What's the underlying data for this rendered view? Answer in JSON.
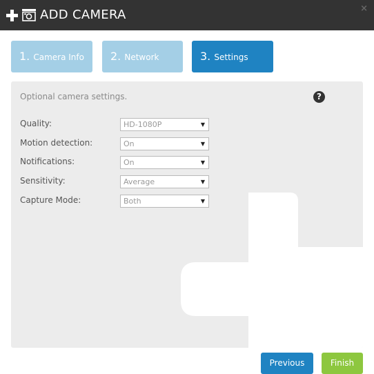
{
  "header": {
    "title": "ADD CAMERA",
    "icons": [
      "plus-icon",
      "camera-icon"
    ],
    "close_glyph": "×",
    "background": "#333333"
  },
  "steps": [
    {
      "number": "1.",
      "label": "Camera Info",
      "state": "completed",
      "color": "#a4cfe6"
    },
    {
      "number": "2.",
      "label": "Network",
      "state": "completed",
      "color": "#a4cfe6"
    },
    {
      "number": "3.",
      "label": "Settings",
      "state": "active",
      "color": "#1f83c2"
    }
  ],
  "panel": {
    "description": "Optional camera settings.",
    "help_glyph": "?"
  },
  "settings": {
    "quality": {
      "label": "Quality:",
      "value": "HD-1080P"
    },
    "motion_detection": {
      "label": "Motion detection:",
      "value": "On"
    },
    "notifications": {
      "label": "Notifications:",
      "value": "On"
    },
    "sensitivity": {
      "label": "Sensitivity:",
      "value": "Average"
    },
    "capture_mode": {
      "label": "Capture Mode:",
      "value": "Both"
    }
  },
  "footer": {
    "previous_label": "Previous",
    "finish_label": "Finish",
    "previous_color": "#1f83c2",
    "finish_color": "#8dc73f"
  }
}
